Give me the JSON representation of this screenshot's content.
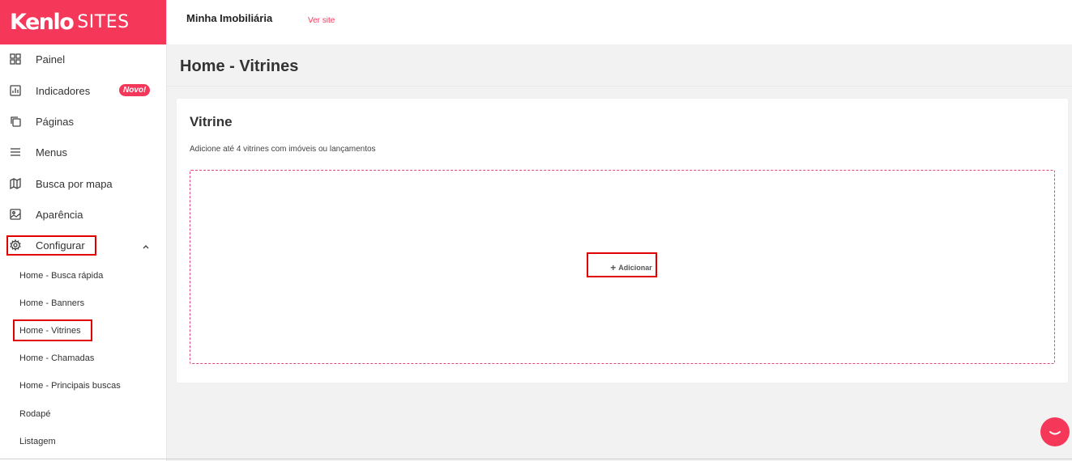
{
  "brand": {
    "logo": "Kenlo",
    "product": "SITES",
    "color": "#f5385a"
  },
  "topbar": {
    "org_name": "Minha Imobiliária",
    "view_site": "Ver site"
  },
  "sidebar": {
    "items": [
      {
        "label": "Painel",
        "icon": "grid-icon"
      },
      {
        "label": "Indicadores",
        "icon": "chart-icon",
        "badge": "Novo!"
      },
      {
        "label": "Páginas",
        "icon": "pages-icon"
      },
      {
        "label": "Menus",
        "icon": "menu-icon"
      },
      {
        "label": "Busca por mapa",
        "icon": "map-icon"
      },
      {
        "label": "Aparência",
        "icon": "image-icon"
      },
      {
        "label": "Configurar",
        "icon": "gear-icon",
        "expanded": true
      }
    ],
    "subitems": [
      "Home - Busca rápida",
      "Home - Banners",
      "Home - Vitrines",
      "Home - Chamadas",
      "Home - Principais buscas",
      "Rodapé",
      "Listagem"
    ]
  },
  "page": {
    "title": "Home - Vitrines"
  },
  "card": {
    "title": "Vitrine",
    "description": "Adicione até 4 vitrines com imóveis ou lançamentos",
    "add_label": "Adicionar"
  }
}
